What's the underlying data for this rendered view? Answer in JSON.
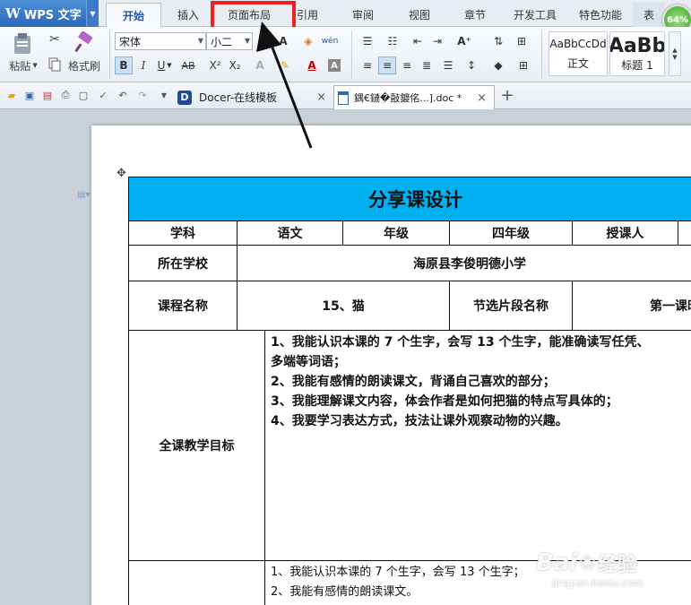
{
  "app": {
    "name": "WPS 文字",
    "zoom": "64%"
  },
  "menu": {
    "tabs": [
      {
        "label": "开始",
        "active": true
      },
      {
        "label": "插入"
      },
      {
        "label": "页面布局",
        "highlighted": true
      },
      {
        "label": "引用"
      },
      {
        "label": "审阅"
      },
      {
        "label": "视图"
      },
      {
        "label": "章节"
      },
      {
        "label": "开发工具"
      },
      {
        "label": "特色功能"
      },
      {
        "label": "表"
      }
    ]
  },
  "ribbon": {
    "paste_label": "粘贴",
    "format_painter_label": "格式刷",
    "font_name": "宋体",
    "font_size": "小二",
    "style_normal_preview": "AaBbCcDd",
    "style_normal_label": "正文",
    "style_heading_preview": "AaBb",
    "style_heading_label": "标题 1",
    "colors": {
      "accent": "#2c67b8",
      "highlight_box": "#ee2024",
      "title_cell": "#00b0f0"
    }
  },
  "doc_tabs": [
    {
      "label": "Docer-在线模板",
      "icon": "docer-logo-icon"
    },
    {
      "label": "鍝€鏈�敼鍍佲...].doc *",
      "icon": "wps-doc-icon",
      "active": true
    }
  ],
  "document": {
    "title": "分享课设计",
    "row1": [
      "学科",
      "语文",
      "年级",
      "四年级",
      "授课人",
      ""
    ],
    "school_label": "所在学校",
    "school_value": "海原县李俊明德小学",
    "course_label": "课程名称",
    "course_value": "15、猫",
    "segment_label": "节选片段名称",
    "segment_value": "第一课时",
    "goals_label": "全课教学目标",
    "goals": [
      "1、我能认识本课的 7 个生字，会写 13 个生字，能准确读写任凭、",
      "多端等词语；",
      "2、我能有感情的朗读课文，背诵自己喜欢的部分；",
      "3、我能理解课文内容，体会作者是如何把猫的特点写具体的；",
      "4、我要学习表达方式，技法让课外观察动物的兴趣。"
    ],
    "goals_part2": [
      "1、我能认识本课的 7 个生字，会写 13 个生字；",
      "2、我能有感情的朗读课文。"
    ]
  },
  "watermark": {
    "brand": "Bai",
    "brand_suffix": "经验",
    "url": "jingyan.baidu.com"
  }
}
